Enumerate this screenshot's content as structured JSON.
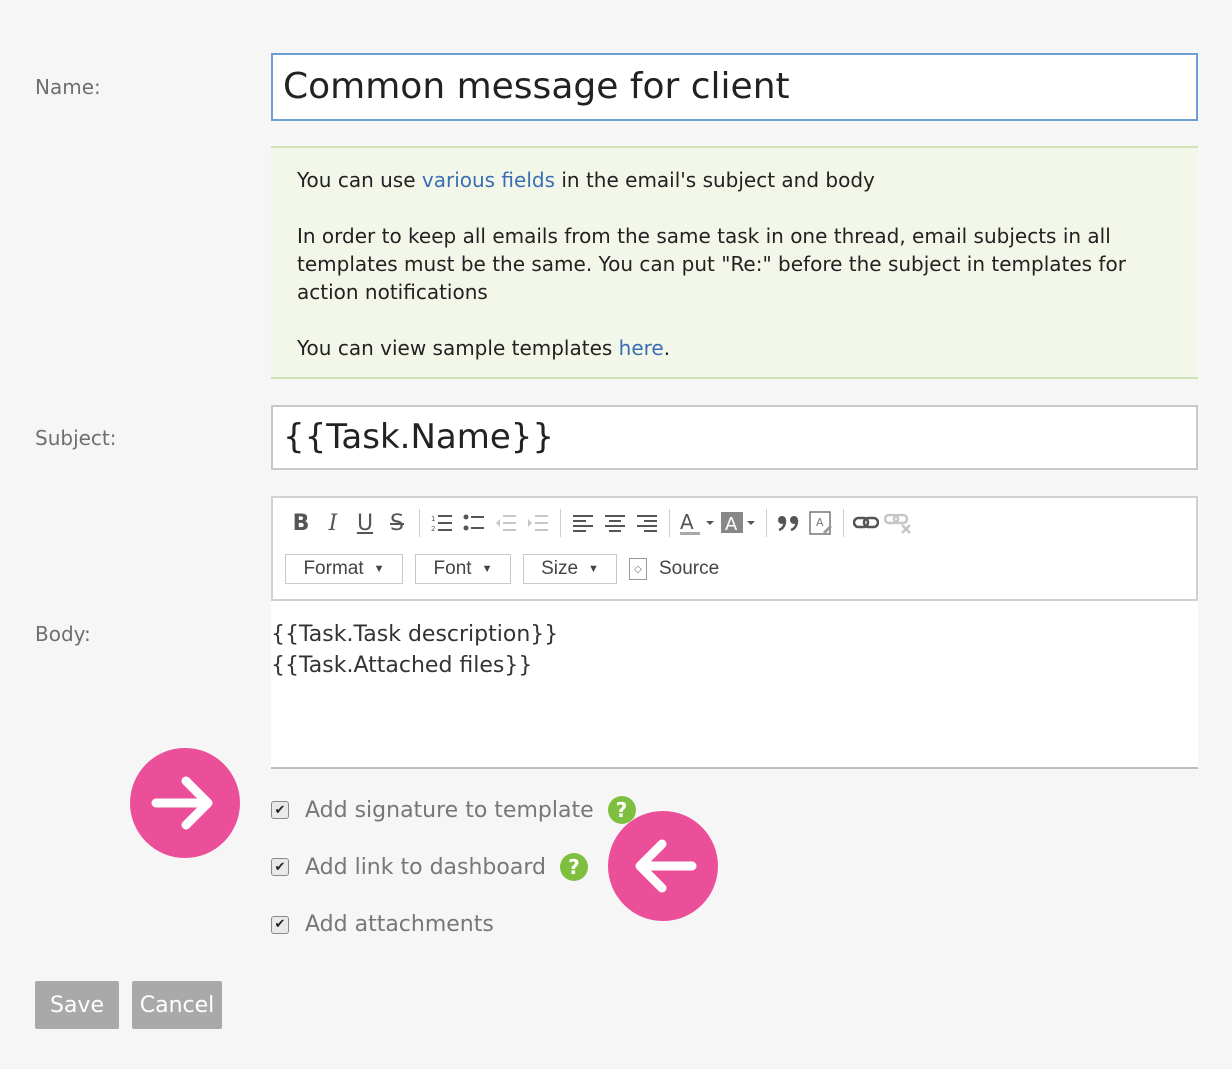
{
  "labels": {
    "name": "Name:",
    "subject": "Subject:",
    "body": "Body:"
  },
  "name_value": "Common message for client",
  "info": {
    "line1_pre": "You can use ",
    "line1_link": "various fields",
    "line1_post": " in the email's subject and body",
    "line2": "In order to keep all emails from the same task in one thread, email subjects in all templates must be the same. You can put \"Re:\" before the subject in templates for action notifications",
    "line3_pre": "You can view sample templates ",
    "line3_link": "here",
    "line3_post": "."
  },
  "subject_value": "{{Task.Name}}",
  "toolbar": {
    "format": "Format",
    "font": "Font",
    "size": "Size",
    "source": "Source"
  },
  "body_lines": [
    "{{Task.Task description}}",
    "{{Task.Attached files}}"
  ],
  "checkboxes": [
    {
      "label": "Add signature to template",
      "checked": true,
      "help": true
    },
    {
      "label": "Add link to dashboard",
      "checked": true,
      "help": true
    },
    {
      "label": "Add attachments",
      "checked": true,
      "help": false
    }
  ],
  "buttons": {
    "save": "Save",
    "cancel": "Cancel"
  },
  "colors": {
    "accent_pink": "#ec4f99",
    "help_green": "#7fbf3f",
    "link_blue": "#3a6eb4"
  }
}
